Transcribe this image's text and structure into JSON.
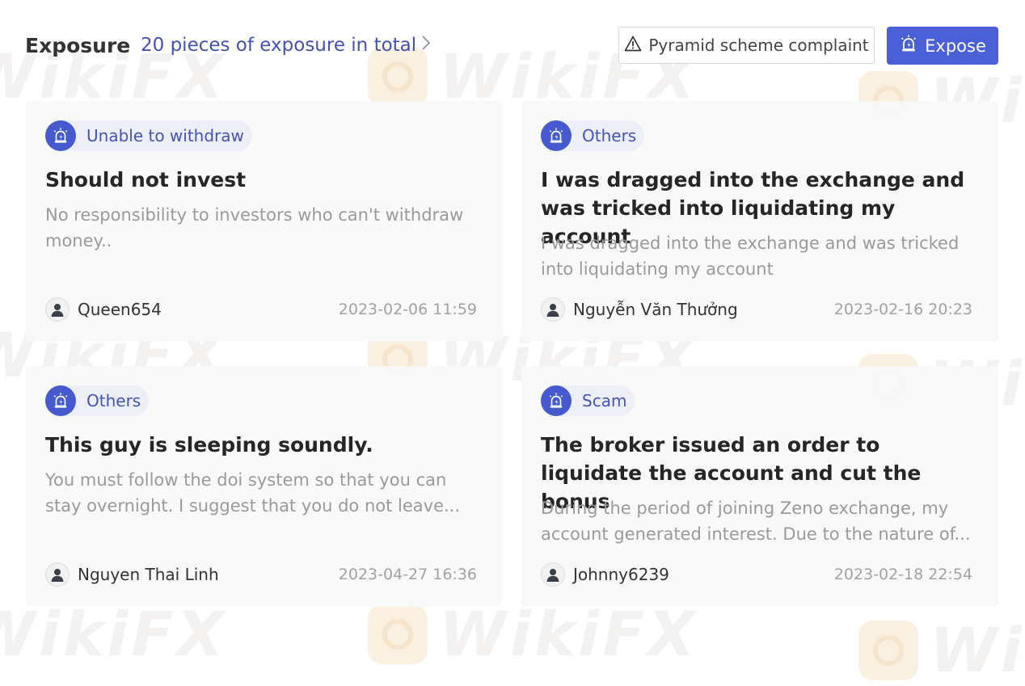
{
  "header": {
    "title": "Exposure",
    "total_link": "20 pieces of exposure in total",
    "complaint_button": "Pyramid scheme complaint",
    "expose_button": "Expose"
  },
  "watermark_text": "WikiFX",
  "colors": {
    "accent": "#4b5fd6",
    "tag_text": "#4454b8",
    "muted_text": "#9a9a9a",
    "card_bg": "#f8f8fa"
  },
  "icons": {
    "tag": "alarm-siren-icon",
    "complaint": "warning-triangle-icon",
    "expose": "alarm-siren-icon",
    "avatar": "user-avatar-icon",
    "total_link": "chevron-right-icon"
  },
  "cards": [
    {
      "tag": "Unable to withdraw",
      "title": "Should not invest",
      "description": "No responsibility to investors who can't withdraw money..",
      "user": "Queen654",
      "date": "2023-02-06 11:59"
    },
    {
      "tag": "Others",
      "title": "I was dragged into the exchange and was tricked into liquidating my account",
      "description": "I was dragged into the exchange and was tricked into liquidating my account",
      "user": "Nguyễn Văn Thưởng",
      "date": "2023-02-16 20:23"
    },
    {
      "tag": "Others",
      "title": "This guy is sleeping soundly.",
      "description": "You must follow the doi system so that you can stay overnight. I suggest that you do not leave...",
      "user": "Nguyen Thai Linh",
      "date": "2023-04-27 16:36"
    },
    {
      "tag": "Scam",
      "title": "The broker issued an order to liquidate the account and cut the bonus",
      "description": "During the period of joining Zeno exchange, my account generated interest. Due to the nature of...",
      "user": "Johnny6239",
      "date": "2023-02-18 22:54"
    }
  ]
}
